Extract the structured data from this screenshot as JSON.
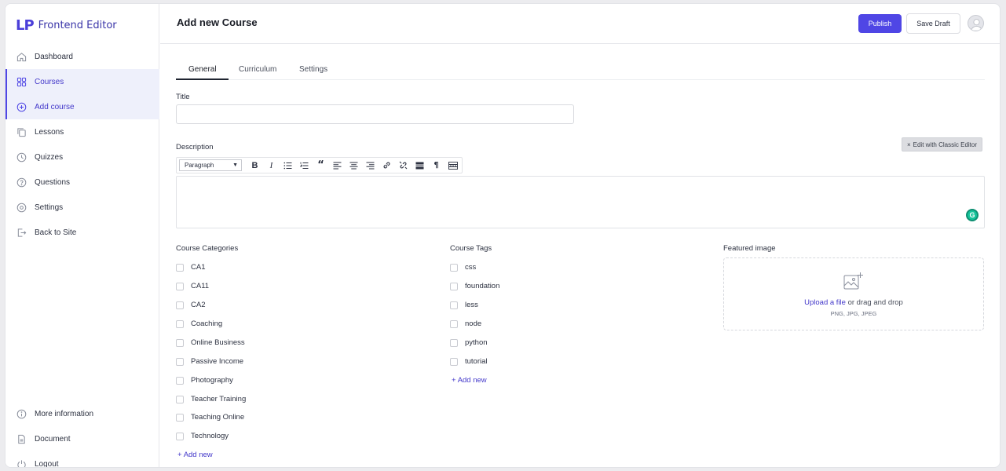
{
  "app": {
    "logo_mark": "LP",
    "logo_text": "Frontend Editor"
  },
  "sidebar": {
    "items": [
      {
        "label": "Dashboard",
        "icon": "home-icon"
      },
      {
        "label": "Courses",
        "icon": "grid-icon",
        "active": true
      },
      {
        "label": "Add course",
        "icon": "plus-circle-icon",
        "active": true
      },
      {
        "label": "Lessons",
        "icon": "copy-icon"
      },
      {
        "label": "Quizzes",
        "icon": "clock-icon"
      },
      {
        "label": "Questions",
        "icon": "help-circle-icon"
      },
      {
        "label": "Settings",
        "icon": "gear-icon"
      },
      {
        "label": "Back to Site",
        "icon": "exit-icon"
      }
    ],
    "bottom_items": [
      {
        "label": "More information",
        "icon": "info-icon"
      },
      {
        "label": "Document",
        "icon": "file-icon"
      },
      {
        "label": "Logout",
        "icon": "power-icon"
      }
    ]
  },
  "header": {
    "title": "Add new Course",
    "publish_label": "Publish",
    "save_draft_label": "Save Draft"
  },
  "tabs": [
    {
      "label": "General",
      "active": true
    },
    {
      "label": "Curriculum"
    },
    {
      "label": "Settings"
    }
  ],
  "form": {
    "title_label": "Title",
    "title_value": "",
    "description_label": "Description",
    "classic_editor_label": "Edit with Classic Editor",
    "paragraph_select": "Paragraph",
    "categories_label": "Course Categories",
    "categories": [
      "CA1",
      "CA11",
      "CA2",
      "Coaching",
      "Online Business",
      "Passive Income",
      "Photography",
      "Teacher Training",
      "Teaching Online",
      "Technology"
    ],
    "categories_add": "Add new",
    "tags_label": "Course Tags",
    "tags": [
      "css",
      "foundation",
      "less",
      "node",
      "python",
      "tutorial"
    ],
    "tags_add": "Add new",
    "featured_label": "Featured image",
    "upload_link": "Upload a file",
    "upload_text": "or drag and drop",
    "upload_hint": "PNG, JPG, JPEG"
  },
  "colors": {
    "accent": "#4f46e5",
    "grammarly": "#15c39a"
  }
}
